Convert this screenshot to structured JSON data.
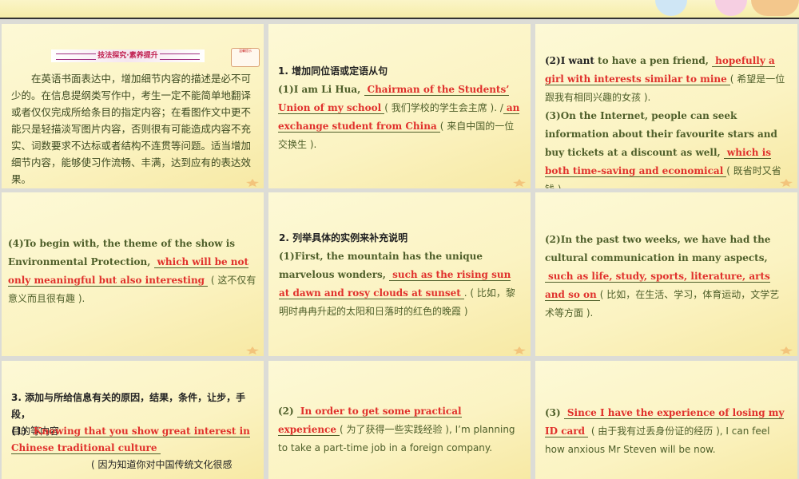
{
  "cells": {
    "c1": {
      "banner": "技法探究·素养提升",
      "note": "温馨提示",
      "body": "在英语书面表达中，增加细节内容的描述是必不可少的。在信息提纲类写作中，考生一定不能简单地翻译或者仅仅完成所给条目的指定内容；在看图作文中更不能只是轻描淡写图片内容，否则很有可能造成内容不充实、词数要求不达标或者结构不连贯等问题。适当增加细节内容，能够使习作流畅、丰满，达到应有的表达效果。"
    },
    "c2": {
      "heading": "1.  增加同位语或定语从句",
      "p1": "(1)I am Li Hua, ",
      "a1": "Chairman of the Students’ Union of my school",
      "t1": "( 我们学校的学生会主席 ). /",
      "a2": "an exchange student from China",
      "t2": "( 来自中国的一位交换生 )."
    },
    "c3": {
      "p1a": "(2)I want",
      "p1b": " to have a pen friend, ",
      "a1": "hopefully a girl with interests similar to mine",
      "t1": "( 希望是一位跟我有相同兴趣的女孩 ).",
      "p2": "(3)On the Internet,  people can seek information about their favourite stars and buy tickets at a discount as well, ",
      "a2": "which is both time-saving and economical",
      "t2": "( 既省时又省钱 )."
    },
    "c4": {
      "p1": "(4)To begin with,  the theme of the show is Environmental Protection, ",
      "a1": "which will be not only meaningful but also interesting",
      "t1": " ( 这不仅有意义而且很有趣 )."
    },
    "c5": {
      "heading": "2.  列举具体的实例来补充说明",
      "p1": "(1)First,  the mountain has the unique marvelous wonders, ",
      "a1": "such as the rising sun at dawn and rosy clouds at sunset",
      "t1": ". ( 比如，黎明时冉冉升起的太阳和日落时的红色的晚霞 )"
    },
    "c6": {
      "p1": "(2)In the past two weeks,  we have had the cultural communication in many aspects, ",
      "a1": "such as life,  study, sports,  literature,  arts and so on",
      "t1": "( 比如，在生活、学习，体育运动，文学艺术等方面 )."
    },
    "c7": {
      "heading": "3.  添加与所给信息有关的原因，结果，条件，让步，手段，",
      "heading2": "目的等内容",
      "num": "(1)",
      "a1": "Knowing that you show great interest in Chinese traditional culture",
      "t1": "( 因为知道你对中国传统文化很感"
    },
    "c8": {
      "p0": "(2) ",
      "a1": "In order to get some practical experience",
      "t1": "( 为了获得一些实践经验 ),  I’m planning to take a part-time job in a foreign company."
    },
    "c9": {
      "p0": "(3) ",
      "a1": "Since I have the experience of losing my ID card",
      "t1": " ( 由于我有过丢身份证的经历 ), I can feel how anxious Mr Steven will be now."
    }
  }
}
